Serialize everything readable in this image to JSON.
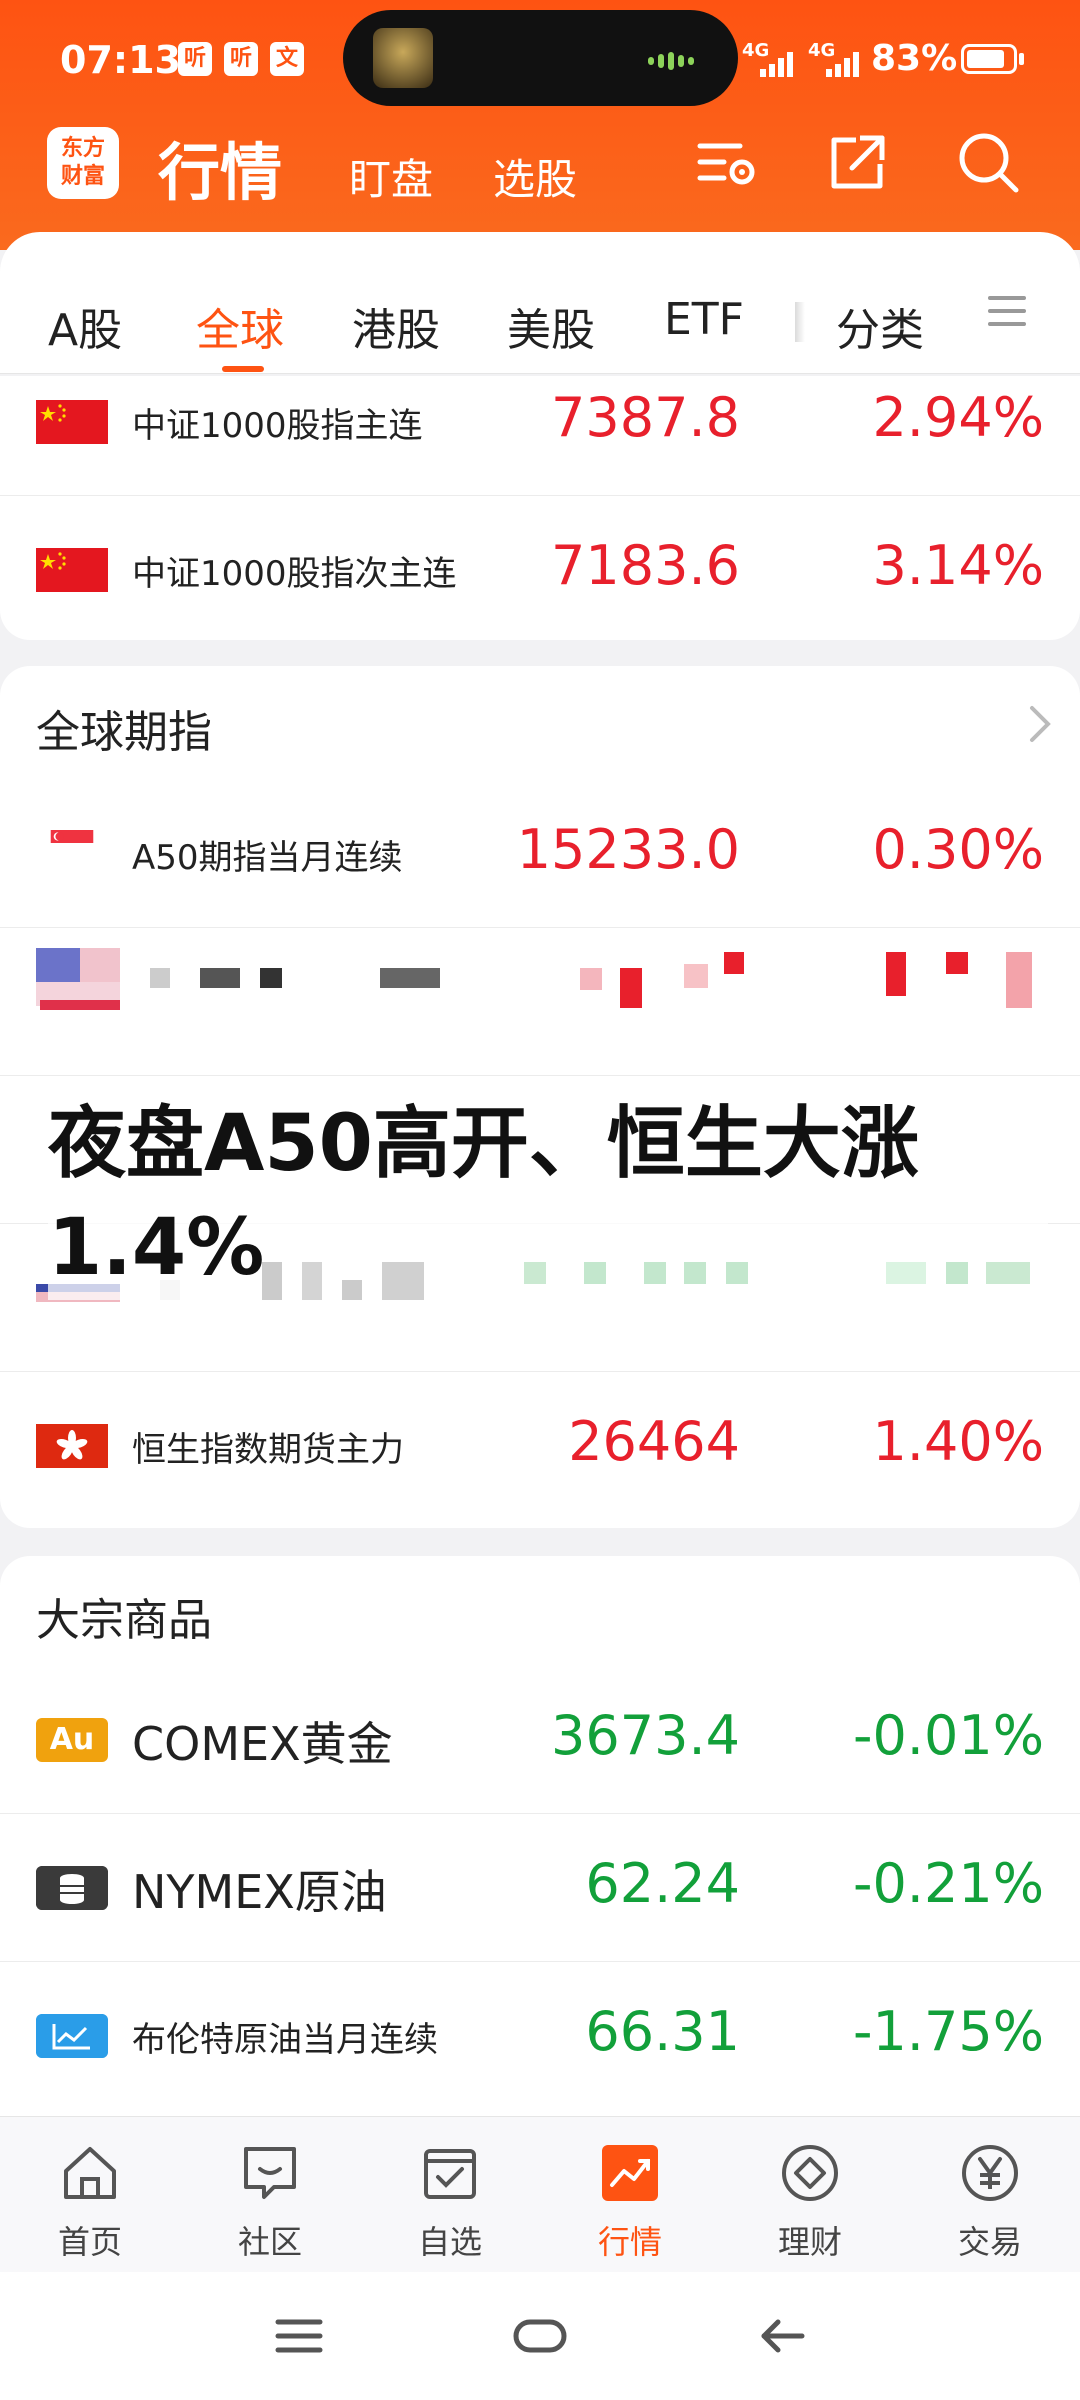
{
  "status_bar": {
    "time": "07:13",
    "notif_icons": [
      "听",
      "听",
      "文"
    ],
    "signal_labels": [
      "4G",
      "4G"
    ],
    "battery": "83%",
    "battery_level": 0.83
  },
  "header": {
    "logo_text_line1": "东方",
    "logo_text_line2": "财富",
    "title": "行情",
    "nav_items": [
      "盯盘",
      "选股"
    ]
  },
  "tabs": {
    "items": [
      "A股",
      "全球",
      "港股",
      "美股",
      "ETF",
      "分类"
    ],
    "active_index": 1
  },
  "china_index": {
    "rows": [
      {
        "name": "中证1000股指主连",
        "price": "7387.8",
        "change": "2.94%",
        "trend": "up"
      },
      {
        "name": "中证1000股指次主连",
        "price": "7183.6",
        "change": "3.14%",
        "trend": "up"
      }
    ]
  },
  "global_futures": {
    "title": "全球期指",
    "rows": [
      {
        "name": "A50期指当月连续",
        "price": "15233.0",
        "change": "0.30%",
        "trend": "up"
      },
      {
        "name": "恒生指数期货主力",
        "price": "26464",
        "change": "1.40%",
        "trend": "up"
      }
    ]
  },
  "overlay": {
    "headline": "夜盘A50高开、恒生大涨1.4%"
  },
  "commodities": {
    "title": "大宗商品",
    "rows": [
      {
        "name": "COMEX黄金",
        "price": "3673.4",
        "change": "-0.01%",
        "trend": "down",
        "icon": "Au"
      },
      {
        "name": "NYMEX原油",
        "price": "62.24",
        "change": "-0.21%",
        "trend": "down",
        "icon": "oil-barrel-icon"
      },
      {
        "name": "布伦特原油当月连续",
        "price": "66.31",
        "change": "-1.75%",
        "trend": "down",
        "icon": "line-chart-icon"
      }
    ]
  },
  "bottom_nav": {
    "items": [
      "首页",
      "社区",
      "自选",
      "行情",
      "理财",
      "交易"
    ],
    "active_index": 3
  },
  "colors": {
    "brand": "#fe5312",
    "up": "#e8202c",
    "down": "#12a03a"
  }
}
